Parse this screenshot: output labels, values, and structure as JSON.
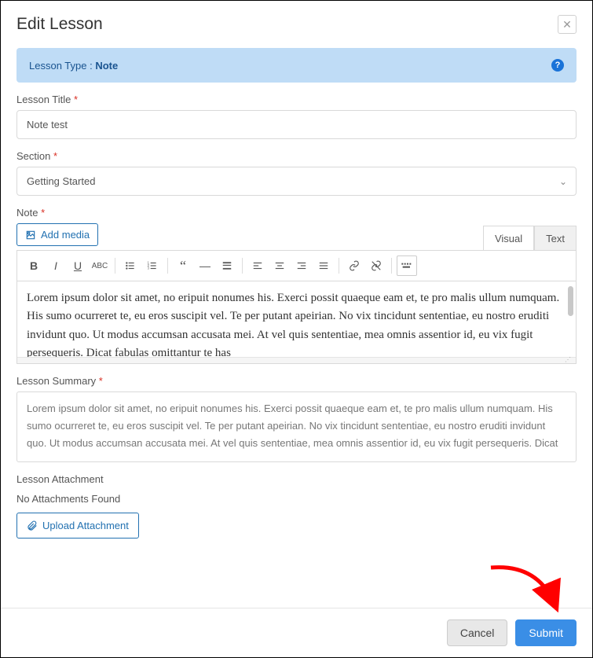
{
  "header": {
    "title": "Edit Lesson"
  },
  "banner": {
    "prefix": "Lesson Type : ",
    "value": "Note"
  },
  "fields": {
    "title_label": "Lesson Title",
    "title_value": "Note test",
    "section_label": "Section",
    "section_value": "Getting Started",
    "note_label": "Note",
    "add_media": "Add media",
    "tabs": {
      "visual": "Visual",
      "text": "Text"
    },
    "note_content": "Lorem ipsum dolor sit amet, no eripuit nonumes his. Exerci possit quaeque eam et, te pro malis ullum numquam. His sumo ocurreret te, eu eros suscipit vel. Te per putant apeirian. No vix tincidunt sententiae, eu nostro eruditi invidunt quo. Ut modus accumsan accusata mei. At vel quis sententiae, mea omnis assentior id, eu vix fugit persequeris. Dicat fabulas omittantur te has",
    "summary_label": "Lesson Summary",
    "summary_value": "Lorem ipsum dolor sit amet, no eripuit nonumes his. Exerci possit quaeque eam et, te pro malis ullum numquam. His sumo ocurreret te, eu eros suscipit vel. Te per putant apeirian. No vix tincidunt sententiae, eu nostro eruditi invidunt quo. Ut modus accumsan accusata mei. At vel quis sententiae, mea omnis assentior id, eu vix fugit persequeris. Dicat",
    "attachment_label": "Lesson Attachment",
    "attachment_none": "No Attachments Found",
    "upload": "Upload Attachment"
  },
  "footer": {
    "cancel": "Cancel",
    "submit": "Submit"
  }
}
